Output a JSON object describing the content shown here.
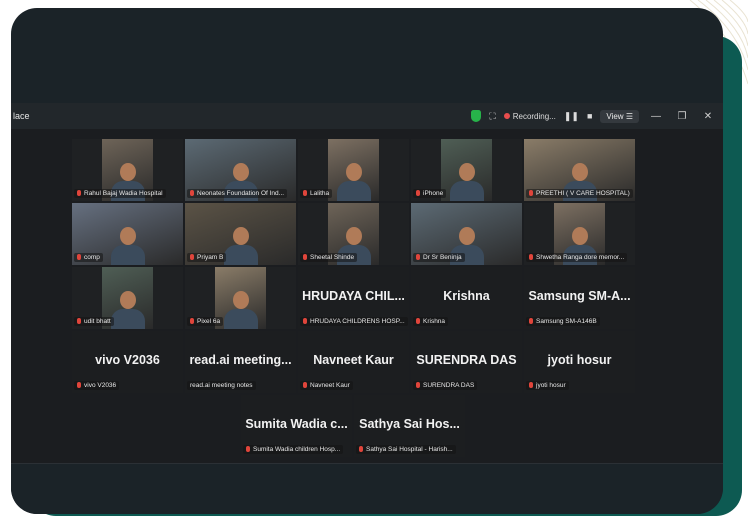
{
  "window": {
    "title_fragment": "lace"
  },
  "toolbar": {
    "recording_label": "Recording...",
    "view_label": "View"
  },
  "tiles": [
    {
      "label": "Rahul Bajaj Wadia Hospital",
      "type": "video",
      "row": 0,
      "col": 0
    },
    {
      "label": "Neonates Foundation Of Ind...",
      "type": "video-wide",
      "row": 0,
      "col": 1
    },
    {
      "label": "Lalitha",
      "type": "video",
      "row": 0,
      "col": 2
    },
    {
      "label": "iPhone",
      "type": "video",
      "row": 0,
      "col": 3
    },
    {
      "label": "PREETHI ( V CARE HOSPITAL)",
      "type": "video-wide",
      "row": 0,
      "col": 4
    },
    {
      "label": "comp",
      "type": "video-wide",
      "row": 1,
      "col": 0
    },
    {
      "label": "Priyam B",
      "type": "video-wide",
      "row": 1,
      "col": 1,
      "active": true
    },
    {
      "label": "Sheetal Shinde",
      "type": "video",
      "row": 1,
      "col": 2
    },
    {
      "label": "Dr Sr Beninja",
      "type": "video-wide",
      "row": 1,
      "col": 3
    },
    {
      "label": "Shwetha Ranga dore memor...",
      "type": "video",
      "row": 1,
      "col": 4
    },
    {
      "label": "udit bhatt",
      "type": "video",
      "row": 2,
      "col": 0
    },
    {
      "label": "Pixel 6a",
      "type": "video",
      "row": 2,
      "col": 1
    },
    {
      "name": "HRUDAYA CHIL...",
      "label": "HRUDAYA CHILDRENS HOSP...",
      "type": "name",
      "row": 2,
      "col": 2
    },
    {
      "name": "Krishna",
      "label": "Krishna",
      "type": "name",
      "row": 2,
      "col": 3
    },
    {
      "name": "Samsung SM-A...",
      "label": "Samsung SM-A146B",
      "type": "name",
      "row": 2,
      "col": 4
    },
    {
      "name": "vivo V2036",
      "label": "vivo V2036",
      "type": "name",
      "row": 3,
      "col": 0
    },
    {
      "name": "read.ai meeting...",
      "label": "read.ai meeting notes",
      "type": "name",
      "row": 3,
      "col": 1,
      "nomic": true
    },
    {
      "name": "Navneet Kaur",
      "label": "Navneet Kaur",
      "type": "name",
      "row": 3,
      "col": 2
    },
    {
      "name": "SURENDRA DAS",
      "label": "SURENDRA DAS",
      "type": "name",
      "row": 3,
      "col": 3
    },
    {
      "name": "jyoti hosur",
      "label": "jyoti hosur",
      "type": "name",
      "row": 3,
      "col": 4
    },
    {
      "name": "Sumita Wadia c...",
      "label": "Sumita Wadia children Hosp...",
      "type": "name",
      "row": 4,
      "col": 0
    },
    {
      "name": "Sathya Sai Hos...",
      "label": "Sathya Sai Hospital - Harish...",
      "type": "name",
      "row": 4,
      "col": 1
    }
  ],
  "colors": {
    "active_border": "#2bc46a",
    "mic_muted": "#e0453b",
    "recording": "#e84d4d",
    "secure": "#27b34a"
  }
}
